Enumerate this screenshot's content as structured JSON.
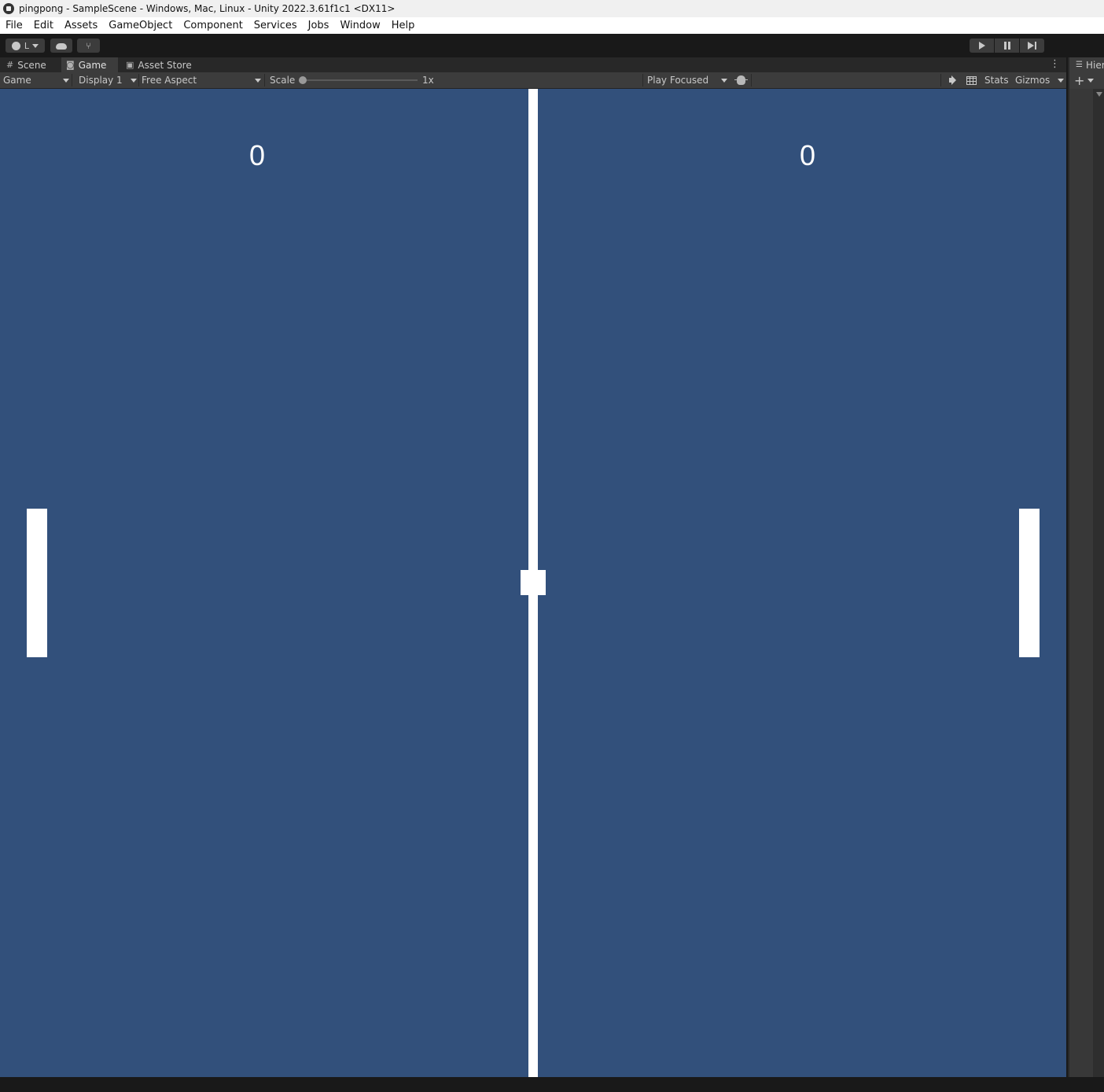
{
  "window": {
    "title": "pingpong - SampleScene - Windows, Mac, Linux - Unity 2022.3.61f1c1 <DX11>"
  },
  "menu": [
    "File",
    "Edit",
    "Assets",
    "GameObject",
    "Component",
    "Services",
    "Jobs",
    "Window",
    "Help"
  ],
  "toolbar": {
    "account_letter": "L"
  },
  "tabs": {
    "scene": "Scene",
    "game": "Game",
    "asset_store": "Asset Store"
  },
  "game_toolbar": {
    "view_mode": "Game",
    "display": "Display 1",
    "aspect": "Free Aspect",
    "scale_label": "Scale",
    "scale_value": "1x",
    "play_mode": "Play Focused",
    "stats": "Stats",
    "gizmos": "Gizmos"
  },
  "game": {
    "score_left": "0",
    "score_right": "0",
    "background_color": "#32507b"
  },
  "hierarchy": {
    "tab_label": "Hierarchy"
  },
  "colors": {
    "editor_dark": "#191919",
    "panel": "#3c3c3c",
    "game_bg": "#32507b",
    "game_white": "#ffffff"
  }
}
